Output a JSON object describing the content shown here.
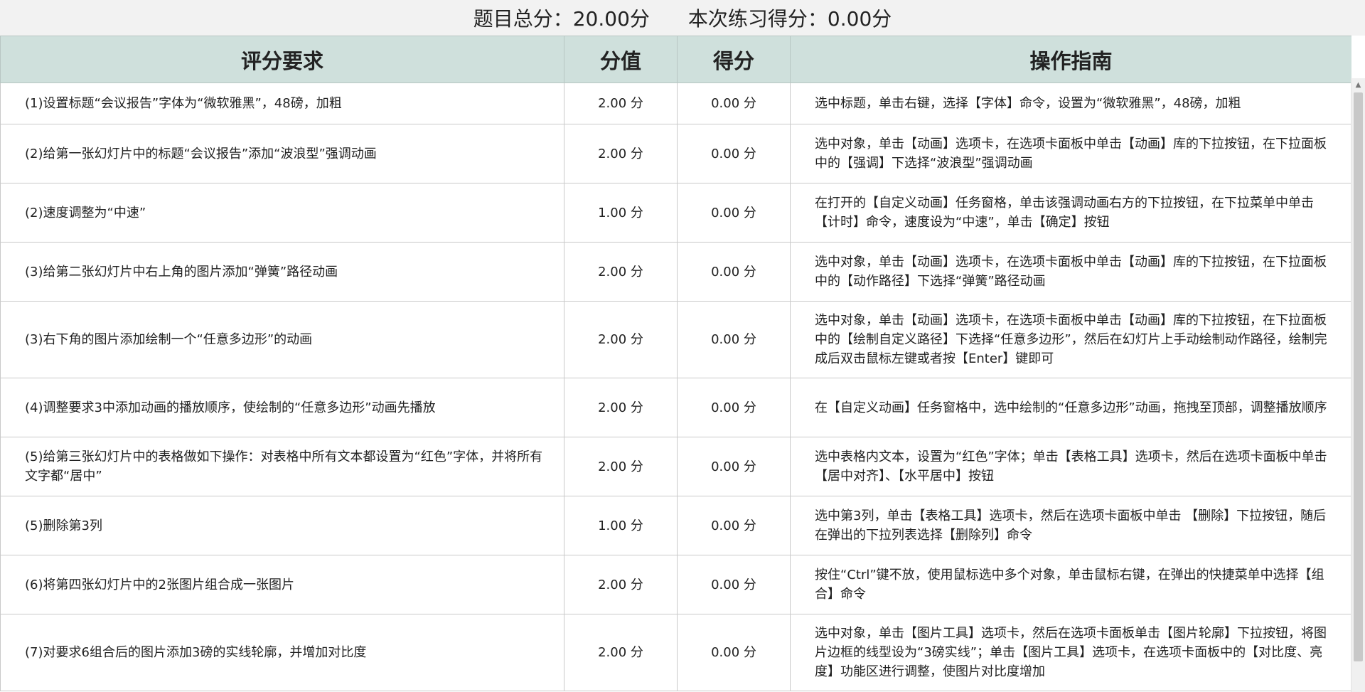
{
  "summary": {
    "total_label": "题目总分：",
    "total_value": "20.00分",
    "score_label": "本次练习得分：",
    "score_value": "0.00分"
  },
  "table": {
    "headers": [
      "评分要求",
      "分值",
      "得分",
      "操作指南"
    ],
    "rows": [
      {
        "req": "(1)设置标题“会议报告”字体为“微软雅黑”，48磅，加粗",
        "value": "2.00 分",
        "score": "0.00 分",
        "guide": "选中标题，单击右键，选择【字体】命令，设置为“微软雅黑”，48磅，加粗"
      },
      {
        "req": "(2)给第一张幻灯片中的标题“会议报告”添加“波浪型”强调动画",
        "value": "2.00 分",
        "score": "0.00 分",
        "guide": "选中对象，单击【动画】选项卡，在选项卡面板中单击【动画】库的下拉按钮，在下拉面板中的【强调】下选择“波浪型”强调动画"
      },
      {
        "req": "(2)速度调整为“中速”",
        "value": "1.00 分",
        "score": "0.00 分",
        "guide": "在打开的【自定义动画】任务窗格，单击该强调动画右方的下拉按钮，在下拉菜单中单击【计时】命令，速度设为“中速”，单击【确定】按钮"
      },
      {
        "req": "(3)给第二张幻灯片中右上角的图片添加“弹簧”路径动画",
        "value": "2.00 分",
        "score": "0.00 分",
        "guide": "选中对象，单击【动画】选项卡，在选项卡面板中单击【动画】库的下拉按钮，在下拉面板中的【动作路径】下选择“弹簧”路径动画"
      },
      {
        "req": "(3)右下角的图片添加绘制一个“任意多边形”的动画",
        "value": "2.00 分",
        "score": "0.00 分",
        "guide": "选中对象，单击【动画】选项卡，在选项卡面板中单击【动画】库的下拉按钮，在下拉面板中的【绘制自定义路径】下选择“任意多边形”，然后在幻灯片上手动绘制动作路径，绘制完成后双击鼠标左键或者按【Enter】键即可"
      },
      {
        "req": "(4)调整要求3中添加动画的播放顺序，使绘制的“任意多边形”动画先播放",
        "value": "2.00 分",
        "score": "0.00 分",
        "guide": "在【自定义动画】任务窗格中，选中绘制的“任意多边形”动画，拖拽至顶部，调整播放顺序"
      },
      {
        "req": "(5)给第三张幻灯片中的表格做如下操作：对表格中所有文本都设置为“红色”字体，并将所有文字都“居中”",
        "value": "2.00 分",
        "score": "0.00 分",
        "guide": "选中表格内文本，设置为“红色”字体；单击【表格工具】选项卡，然后在选项卡面板中单击【居中对齐】、【水平居中】按钮"
      },
      {
        "req": "(5)删除第3列",
        "value": "1.00 分",
        "score": "0.00 分",
        "guide": "选中第3列，单击【表格工具】选项卡，然后在选项卡面板中单击 【删除】下拉按钮，随后在弹出的下拉列表选择【删除列】命令"
      },
      {
        "req": "(6)将第四张幻灯片中的2张图片组合成一张图片",
        "value": "2.00 分",
        "score": "0.00 分",
        "guide": "按住“Ctrl”键不放，使用鼠标选中多个对象，单击鼠标右键，在弹出的快捷菜单中选择【组合】命令"
      },
      {
        "req": "(7)对要求6组合后的图片添加3磅的实线轮廓，并增加对比度",
        "value": "2.00 分",
        "score": "0.00 分",
        "guide": "选中对象，单击【图片工具】选项卡，然后在选项卡面板单击【图片轮廓】下拉按钮，将图片边框的线型设为“3磅实线”；单击【图片工具】选项卡，在选项卡面板中的【对比度、亮度】功能区进行调整，使图片对比度增加"
      }
    ]
  },
  "icons": {
    "scroll_up": "chevron-up-icon"
  }
}
